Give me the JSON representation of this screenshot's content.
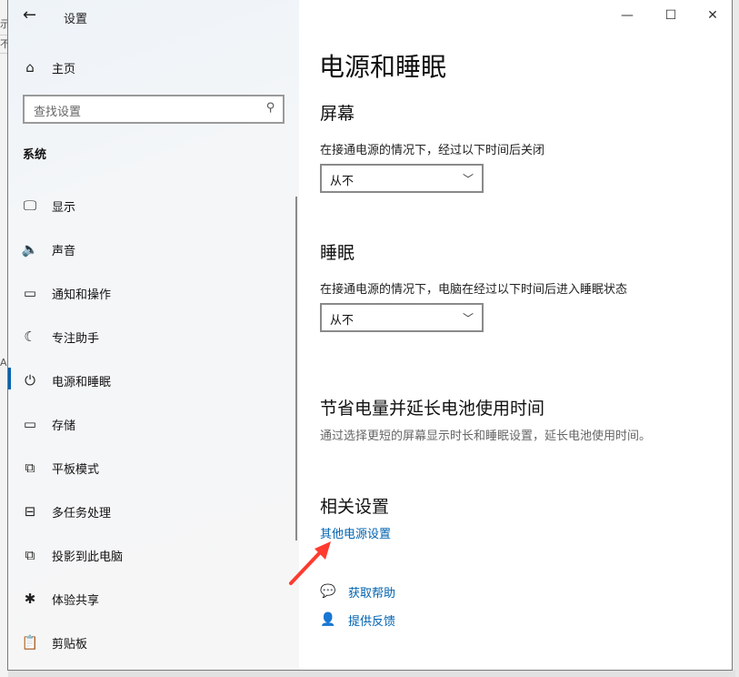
{
  "window": {
    "title": "设置"
  },
  "window_controls": {
    "minimize": "—",
    "maximize": "☐",
    "close": "✕"
  },
  "background_window": {
    "chars": [
      "示",
      "不",
      "A"
    ]
  },
  "sidebar": {
    "home_label": "主页",
    "search_placeholder": "查找设置",
    "section_label": "系统",
    "items": [
      {
        "label": "显示",
        "icon": "monitor-icon",
        "glyph": "🖵"
      },
      {
        "label": "声音",
        "icon": "speaker-icon",
        "glyph": "🔈"
      },
      {
        "label": "通知和操作",
        "icon": "notification-icon",
        "glyph": "▭"
      },
      {
        "label": "专注助手",
        "icon": "moon-icon",
        "glyph": "☾"
      },
      {
        "label": "电源和睡眠",
        "icon": "power-icon",
        "glyph": "⏻",
        "active": true
      },
      {
        "label": "存储",
        "icon": "storage-icon",
        "glyph": "▭"
      },
      {
        "label": "平板模式",
        "icon": "tablet-icon",
        "glyph": "⧉"
      },
      {
        "label": "多任务处理",
        "icon": "multitask-icon",
        "glyph": "⊟"
      },
      {
        "label": "投影到此电脑",
        "icon": "project-icon",
        "glyph": "⧉"
      },
      {
        "label": "体验共享",
        "icon": "share-icon",
        "glyph": "✱"
      },
      {
        "label": "剪贴板",
        "icon": "clipboard-icon",
        "glyph": "📋"
      }
    ],
    "accent_color": "#0063b1"
  },
  "main": {
    "title": "电源和睡眠",
    "screen": {
      "heading": "屏幕",
      "description": "在接通电源的情况下，经过以下时间后关闭",
      "value": "从不"
    },
    "sleep": {
      "heading": "睡眠",
      "description": "在接通电源的情况下，电脑在经过以下时间后进入睡眠状态",
      "value": "从不"
    },
    "battery": {
      "heading": "节省电量并延长电池使用时间",
      "description": "通过选择更短的屏幕显示时长和睡眠设置，延长电池使用时间。"
    },
    "related": {
      "heading": "相关设置",
      "link": "其他电源设置"
    },
    "help": {
      "get_help": "获取帮助",
      "feedback": "提供反馈"
    }
  },
  "annotation": {
    "color": "#ff3b30"
  }
}
